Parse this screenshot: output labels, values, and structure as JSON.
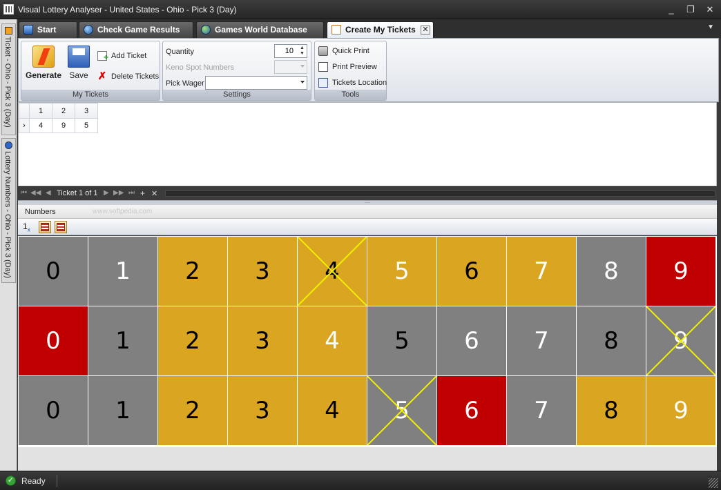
{
  "window": {
    "title": "Visual Lottery Analyser - United States - Ohio - Pick 3 (Day)",
    "minimize": "_",
    "restore": "❐",
    "close": "✕"
  },
  "sidebar": {
    "tabs": [
      {
        "label": "Ticket - Ohio - Pick 3 (Day)",
        "icon": "ticket-icon"
      },
      {
        "label": "Lottery Numbers - Ohio - Pick 3 (Day)",
        "icon": "lottery-numbers-icon"
      }
    ]
  },
  "tabs": [
    {
      "label": "Start",
      "icon": "home-icon",
      "active": false
    },
    {
      "label": "Check Game Results",
      "icon": "globe-check-icon",
      "active": false
    },
    {
      "label": "Games World Database",
      "icon": "globe-icon",
      "active": false
    },
    {
      "label": "Create My Tickets",
      "icon": "ticket-doc-icon",
      "active": true,
      "close": "✕"
    }
  ],
  "tab_menu": "▼",
  "ribbon": {
    "my_tickets": {
      "label": "My Tickets",
      "generate": "Generate",
      "save": "Save",
      "add_ticket": "Add Ticket",
      "delete_tickets": "Delete Tickets"
    },
    "settings": {
      "label": "Settings",
      "quantity_label": "Quantity",
      "quantity_value": "10",
      "keno_label": "Keno Spot Numbers",
      "keno_value": "",
      "pick_wager_label": "Pick Wager",
      "pick_wager_value": ""
    },
    "tools": {
      "label": "Tools",
      "quick_print": "Quick Print",
      "print_preview": "Print Preview",
      "tickets_location": "Tickets Location"
    }
  },
  "ticket_grid": {
    "columns": [
      "1",
      "2",
      "3"
    ],
    "rows": [
      {
        "indicator": "›",
        "values": [
          "4",
          "9",
          "5"
        ]
      }
    ]
  },
  "pager": {
    "first": "⏮",
    "prev_page": "◀◀",
    "prev": "◀",
    "label": "Ticket 1 of 1",
    "next": "▶",
    "next_page": "▶▶",
    "last": "⏭",
    "add": "+",
    "remove": "✕"
  },
  "numbers_panel": {
    "header": "Numbers",
    "watermark": "www.softpedia.com",
    "tool_label": "1",
    "tool_sub": "x"
  },
  "colors": {
    "gray": "#808080",
    "gold": "#DAA520",
    "red": "#C00000",
    "cross": "#F3F000"
  },
  "number_board": {
    "rows": [
      [
        {
          "n": "0",
          "c": "gray",
          "t": "dark",
          "x": false
        },
        {
          "n": "1",
          "c": "gray",
          "t": "light",
          "x": false
        },
        {
          "n": "2",
          "c": "gold",
          "t": "dark",
          "x": false
        },
        {
          "n": "3",
          "c": "gold",
          "t": "dark",
          "x": false
        },
        {
          "n": "4",
          "c": "gold",
          "t": "dark",
          "x": true
        },
        {
          "n": "5",
          "c": "gold",
          "t": "light",
          "x": false
        },
        {
          "n": "6",
          "c": "gold",
          "t": "dark",
          "x": false
        },
        {
          "n": "7",
          "c": "gold",
          "t": "light",
          "x": false
        },
        {
          "n": "8",
          "c": "gray",
          "t": "light",
          "x": false
        },
        {
          "n": "9",
          "c": "red",
          "t": "light",
          "x": false
        }
      ],
      [
        {
          "n": "0",
          "c": "red",
          "t": "light",
          "x": false
        },
        {
          "n": "1",
          "c": "gray",
          "t": "dark",
          "x": false
        },
        {
          "n": "2",
          "c": "gold",
          "t": "dark",
          "x": false
        },
        {
          "n": "3",
          "c": "gold",
          "t": "dark",
          "x": false
        },
        {
          "n": "4",
          "c": "gold",
          "t": "light",
          "x": false
        },
        {
          "n": "5",
          "c": "gray",
          "t": "dark",
          "x": false
        },
        {
          "n": "6",
          "c": "gray",
          "t": "light",
          "x": false
        },
        {
          "n": "7",
          "c": "gray",
          "t": "light",
          "x": false
        },
        {
          "n": "8",
          "c": "gray",
          "t": "dark",
          "x": false
        },
        {
          "n": "9",
          "c": "gray",
          "t": "light",
          "x": true
        }
      ],
      [
        {
          "n": "0",
          "c": "gray",
          "t": "dark",
          "x": false
        },
        {
          "n": "1",
          "c": "gray",
          "t": "dark",
          "x": false
        },
        {
          "n": "2",
          "c": "gold",
          "t": "dark",
          "x": false
        },
        {
          "n": "3",
          "c": "gold",
          "t": "dark",
          "x": false
        },
        {
          "n": "4",
          "c": "gold",
          "t": "dark",
          "x": false
        },
        {
          "n": "5",
          "c": "gray",
          "t": "light",
          "x": true
        },
        {
          "n": "6",
          "c": "red",
          "t": "light",
          "x": false
        },
        {
          "n": "7",
          "c": "gray",
          "t": "light",
          "x": false
        },
        {
          "n": "8",
          "c": "gold",
          "t": "dark",
          "x": false
        },
        {
          "n": "9",
          "c": "gold",
          "t": "light",
          "x": false
        }
      ]
    ]
  },
  "status": {
    "text": "Ready"
  }
}
